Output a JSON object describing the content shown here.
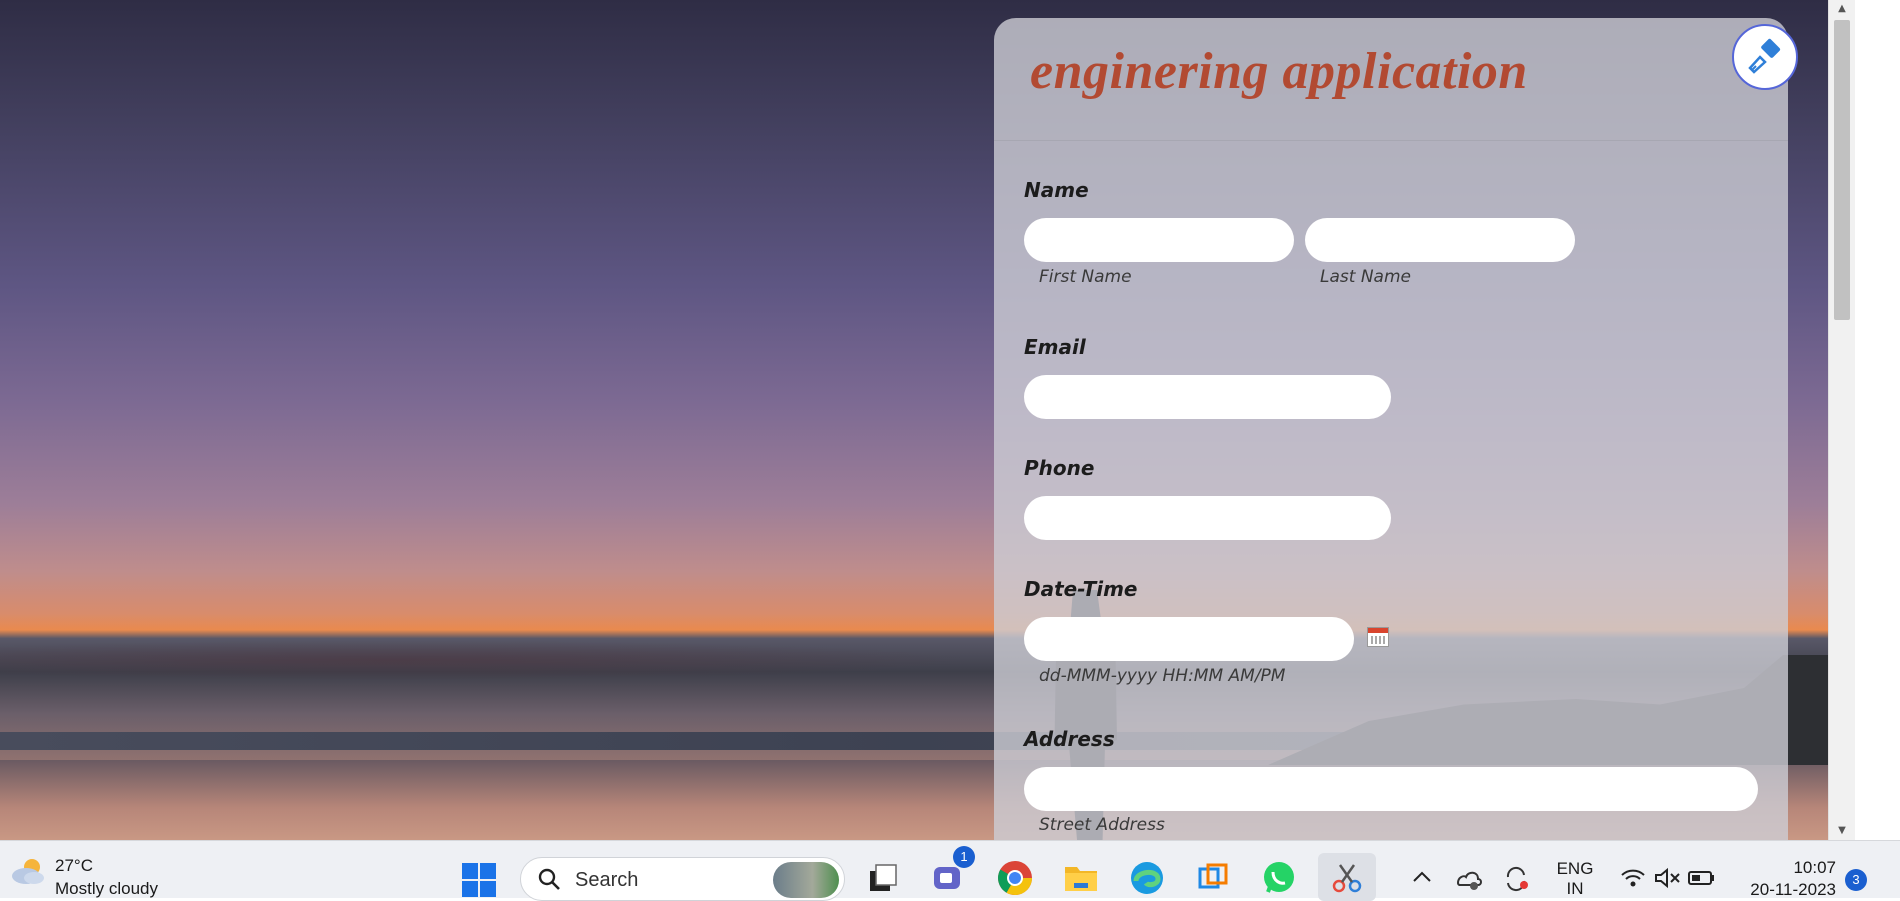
{
  "form": {
    "title": "enginering application",
    "name": {
      "label": "Name",
      "first_sub": "First Name",
      "last_sub": "Last Name"
    },
    "email": {
      "label": "Email"
    },
    "phone": {
      "label": "Phone"
    },
    "datetime": {
      "label": "Date-Time",
      "format_hint": "dd-MMM-yyyy HH:MM AM/PM"
    },
    "address": {
      "label": "Address",
      "street_sub": "Street Address"
    }
  },
  "taskbar": {
    "weather": {
      "temp": "27°C",
      "desc": "Mostly cloudy"
    },
    "search_label": "Search",
    "teams_badge": "1",
    "language_line1": "ENG",
    "language_line2": "IN",
    "time": "10:07",
    "date": "20-11-2023",
    "notification_count": "3"
  },
  "colors": {
    "title": "#b24a32",
    "accent": "#1a5fd0"
  }
}
